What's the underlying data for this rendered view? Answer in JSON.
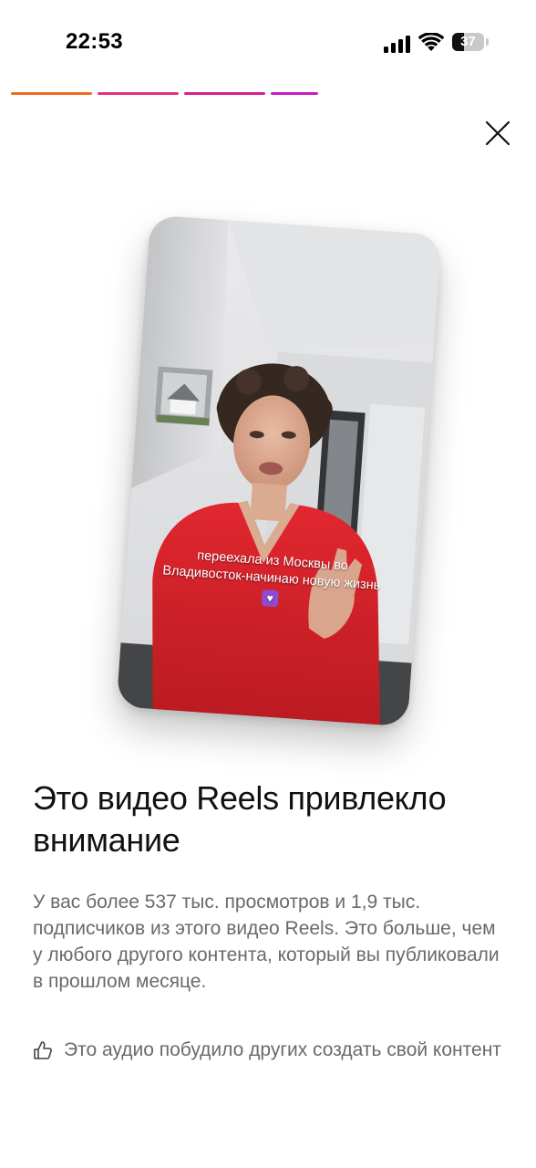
{
  "status_bar": {
    "time": "22:53",
    "battery_level": "37",
    "battery_fraction": 0.37,
    "signal_icon": "cellular-signal-icon",
    "wifi_icon": "wifi-icon",
    "battery_icon": "battery-icon"
  },
  "story_progress": {
    "segments": [
      {
        "color": "#f06a22"
      },
      {
        "color": "#e8307c"
      },
      {
        "color": "#d4218f"
      },
      {
        "color": "#c51fc2"
      }
    ]
  },
  "close_icon": "close-icon",
  "reel": {
    "caption_line1": "переехала из Москвы во",
    "caption_line2": "Владивосток-начинаю новую жизнь",
    "caption_emoji": "♥"
  },
  "headline": "Это видео Reels привлекло внимание",
  "description": "У вас более 537 тыс. просмотров и 1,9 тыс. подписчиков из этого видео Reels. Это больше, чем у любого другого контента, который вы публиковали в прошлом месяце.",
  "audio_note": {
    "icon": "thumbs-up-icon",
    "text": "Это аудио побудило других создать свой контент"
  }
}
